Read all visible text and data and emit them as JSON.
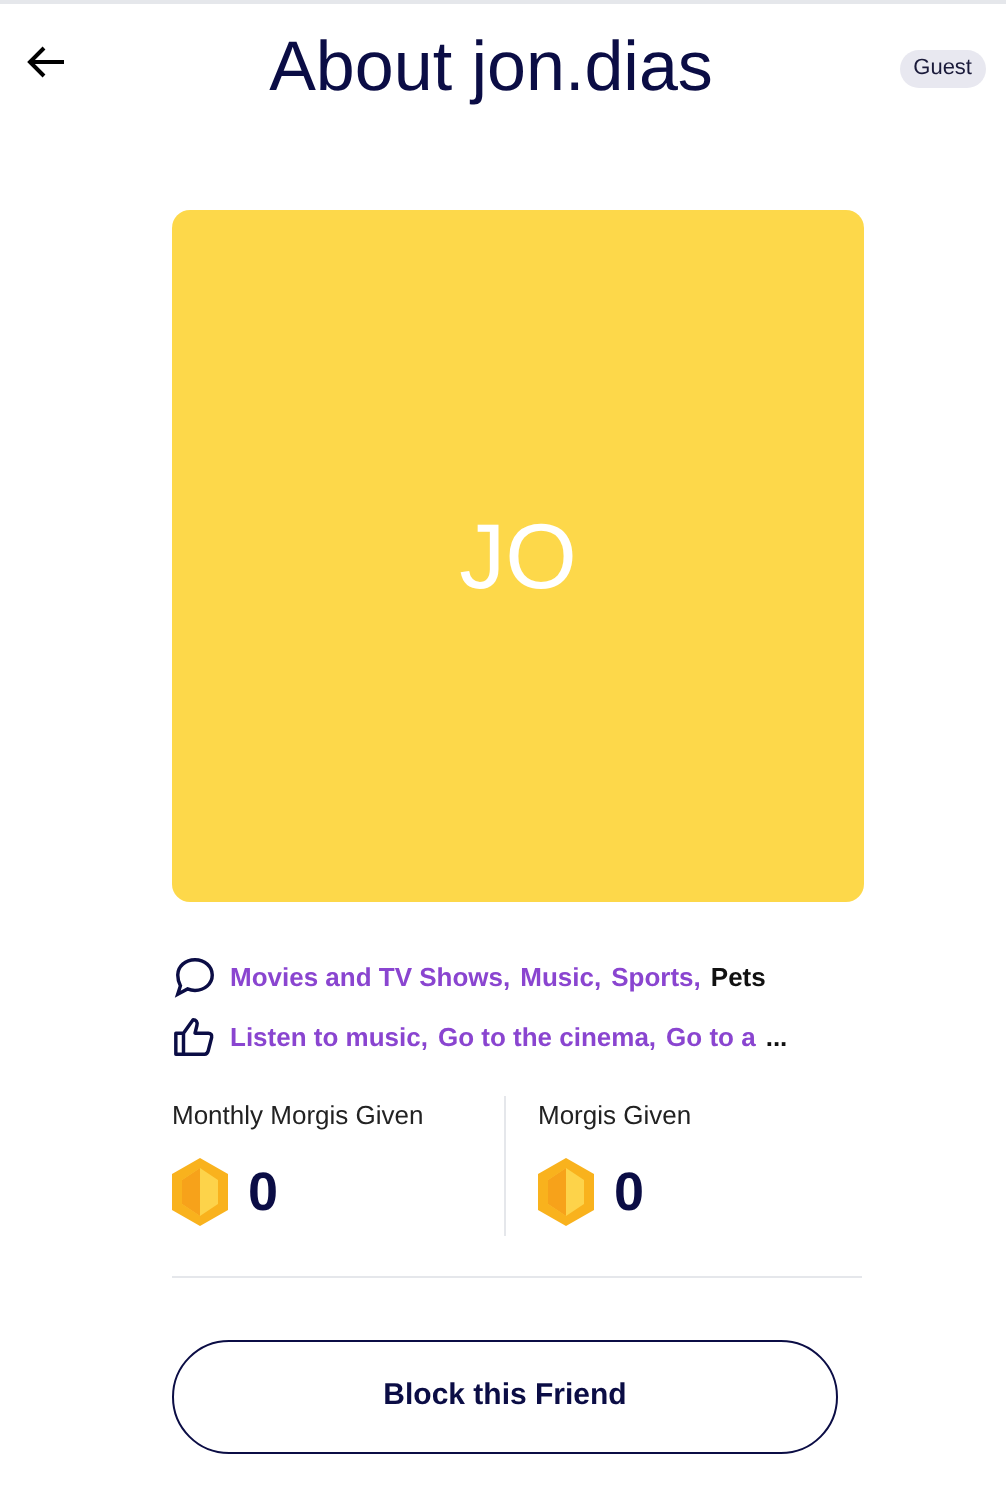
{
  "header": {
    "title": "About jon.dias",
    "badge": "Guest"
  },
  "avatar": {
    "initials": "JO"
  },
  "interests": [
    {
      "label": "Movies and TV Shows,",
      "shared": true
    },
    {
      "label": "Music,",
      "shared": true
    },
    {
      "label": "Sports,",
      "shared": true
    },
    {
      "label": "Pets",
      "shared": false
    }
  ],
  "activities": {
    "items": [
      {
        "label": "Listen to music,",
        "shared": true
      },
      {
        "label": "Go to the cinema,",
        "shared": true
      },
      {
        "label": "Go to a",
        "shared": true
      }
    ],
    "overflow": "..."
  },
  "stats": [
    {
      "label": "Monthly Morgis Given",
      "value": "0"
    },
    {
      "label": "Morgis Given",
      "value": "0"
    }
  ],
  "action": {
    "label": "Block this Friend"
  }
}
